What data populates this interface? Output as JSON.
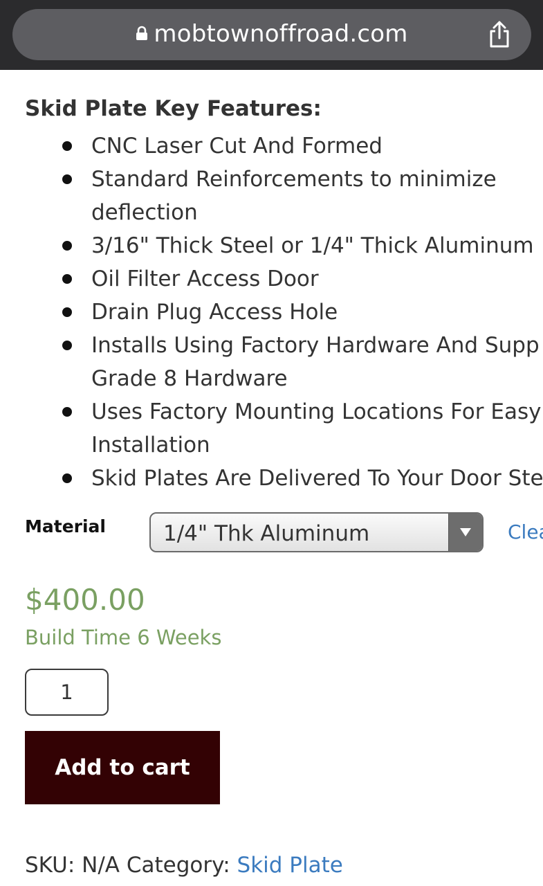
{
  "browser": {
    "url": "mobtownoffroad.com",
    "lock_icon": "lock-icon",
    "share_icon": "share-icon"
  },
  "features": {
    "title": "Skid Plate Key Features:",
    "items": [
      "CNC Laser Cut And Formed",
      "Standard Reinforcements to minimize",
      "deflection",
      "3/16\" Thick Steel or 1/4\" Thick Aluminum",
      "Oil Filter Access Door",
      "Drain Plug Access Hole",
      "Installs Using Factory Hardware And Supp",
      "Grade 8 Hardware",
      "Uses Factory Mounting Locations For Easy",
      "Installation",
      "Skid Plates Are Delivered To Your Door Ste"
    ]
  },
  "variation": {
    "label": "Material",
    "selected": "1/4\" Thk Aluminum",
    "clear_label": "Clea"
  },
  "product": {
    "price": "$400.00",
    "build_time": "Build Time 6 Weeks",
    "quantity": "1",
    "add_to_cart_label": "Add to cart",
    "sku_text": "SKU: N/A Category: ",
    "category_link": "Skid Plate"
  },
  "colors": {
    "price_green": "#7aa062",
    "button_bg": "#330204",
    "link_blue": "#3b7bbf",
    "topbar_bg": "#2b2b2d",
    "urlbar_bg": "#5d5d61"
  }
}
